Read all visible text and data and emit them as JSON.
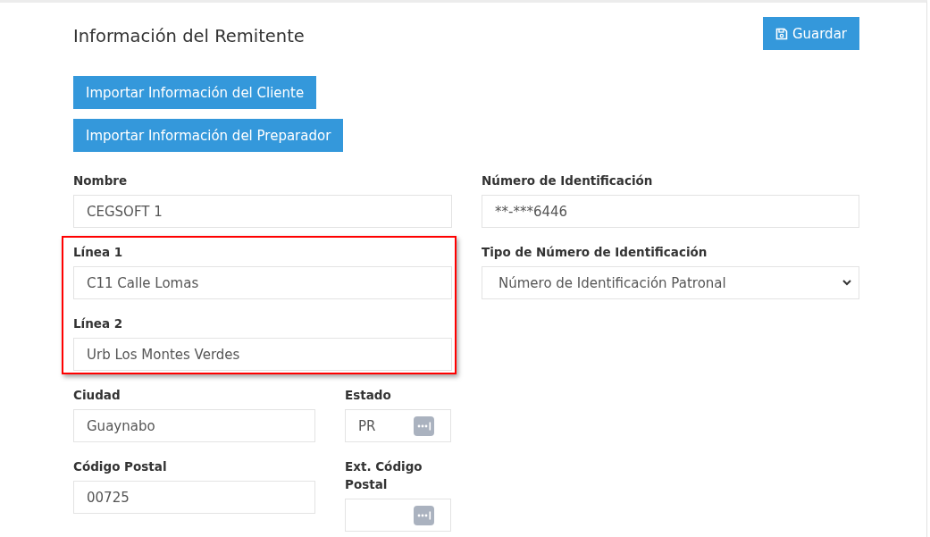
{
  "header": {
    "title": "Información del Remitente",
    "save_button": "Guardar"
  },
  "import_buttons": [
    "Importar Información del Cliente",
    "Importar Información del Preparador"
  ],
  "left_column": [
    {
      "highlighted": false,
      "fields": [
        {
          "kind": "text",
          "label": "Nombre",
          "value": "CEGSOFT 1"
        }
      ]
    },
    {
      "highlighted": true,
      "fields": [
        {
          "kind": "text",
          "label": "Línea 1",
          "value": "C11 Calle Lomas"
        },
        {
          "kind": "text",
          "label": "Línea 2",
          "value": "Urb Los Montes Verdes"
        }
      ]
    }
  ],
  "address_rows": [
    [
      {
        "kind": "text",
        "label": "Ciudad",
        "value": "Guaynabo"
      },
      {
        "kind": "lookup",
        "label": "Estado",
        "value": "PR"
      }
    ],
    [
      {
        "kind": "text",
        "label": "Código Postal",
        "value": "00725"
      },
      {
        "kind": "lookup",
        "label": "Ext. Código Postal"
      }
    ]
  ],
  "right_column": [
    {
      "kind": "text",
      "label": "Número de Identificación",
      "value": "**-***6446"
    },
    {
      "kind": "select",
      "label": "Tipo de Número de Identificación",
      "value": "Número de Identificación Patronal"
    }
  ]
}
